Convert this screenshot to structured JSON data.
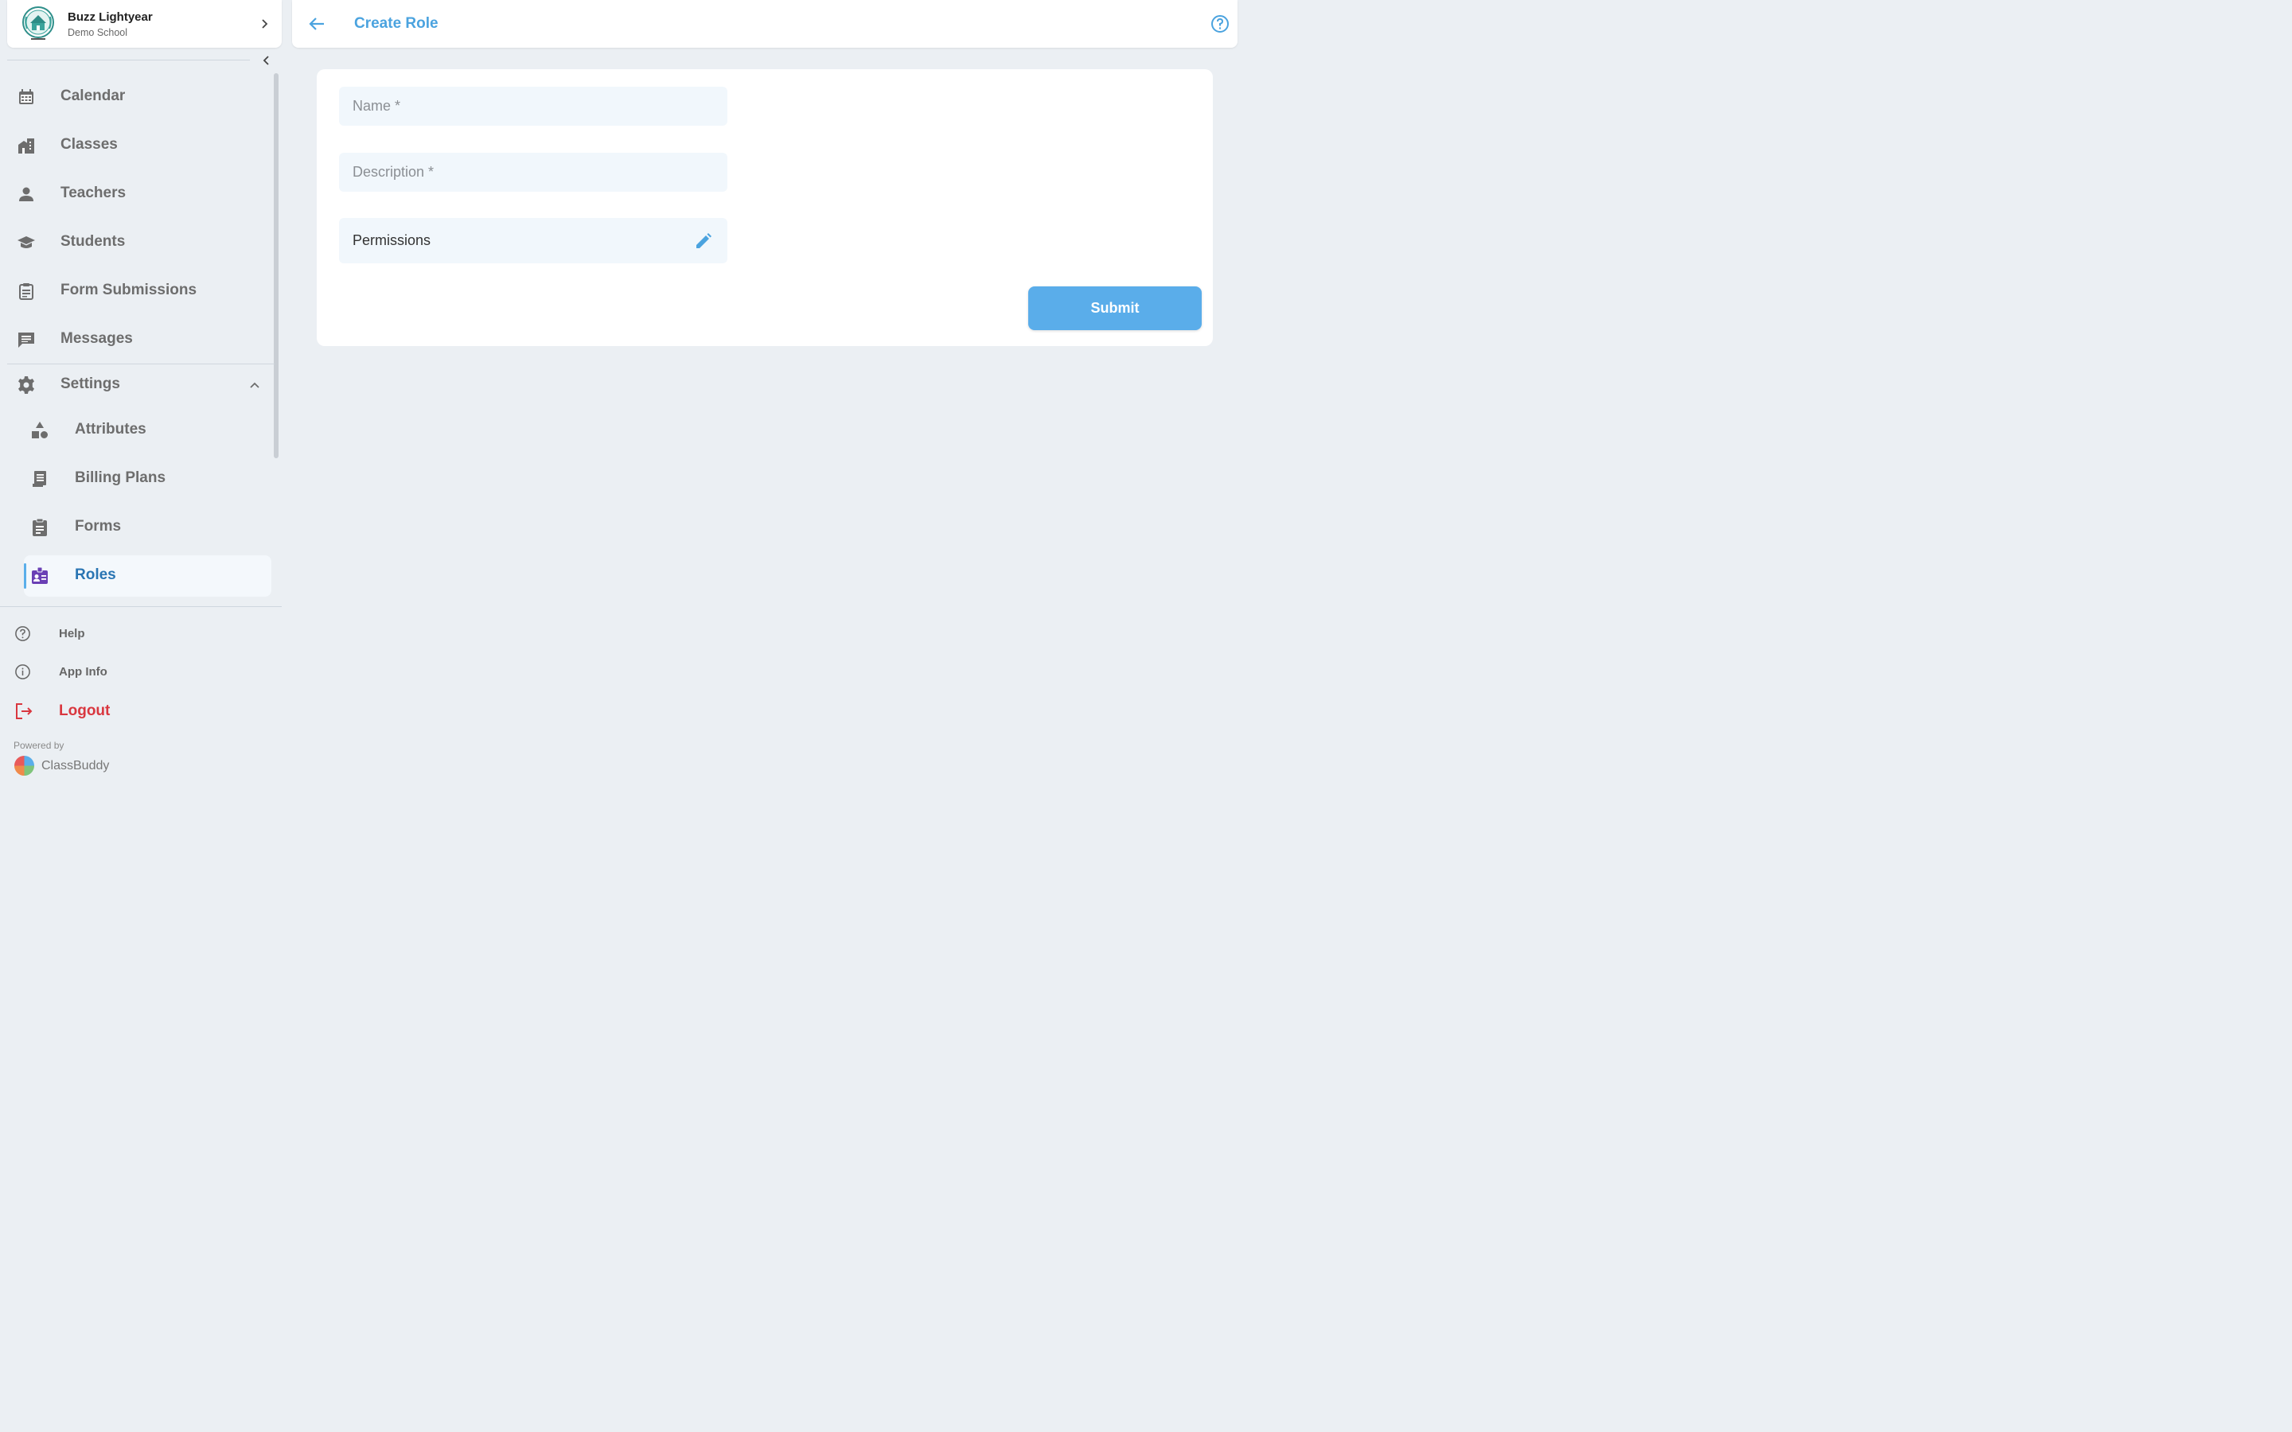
{
  "profile": {
    "name": "Buzz Lightyear",
    "school": "Demo School"
  },
  "sidebar": {
    "items": [
      {
        "label": "Calendar",
        "icon": "calendar-icon"
      },
      {
        "label": "Classes",
        "icon": "building-icon"
      },
      {
        "label": "Teachers",
        "icon": "person-icon"
      },
      {
        "label": "Students",
        "icon": "graduation-cap-icon"
      },
      {
        "label": "Form Submissions",
        "icon": "clipboard-icon"
      },
      {
        "label": "Messages",
        "icon": "message-icon"
      }
    ],
    "settings": {
      "label": "Settings",
      "icon": "gear-icon",
      "expanded": true,
      "children": [
        {
          "label": "Attributes",
          "icon": "shapes-icon"
        },
        {
          "label": "Billing Plans",
          "icon": "receipt-icon"
        },
        {
          "label": "Forms",
          "icon": "clipboard-list-icon"
        },
        {
          "label": "Roles",
          "icon": "id-badge-icon",
          "active": true
        }
      ]
    },
    "footer": {
      "help": "Help",
      "app_info": "App Info",
      "logout": "Logout",
      "powered_by": "Powered by",
      "brand": "ClassBuddy"
    }
  },
  "header": {
    "title": "Create Role"
  },
  "form": {
    "name_placeholder": "Name *",
    "description_placeholder": "Description *",
    "permissions_label": "Permissions",
    "submit_label": "Submit"
  },
  "colors": {
    "accent": "#5aadea",
    "active_text": "#2a75b3",
    "logout": "#d9373f",
    "background": "#ebeff3"
  }
}
